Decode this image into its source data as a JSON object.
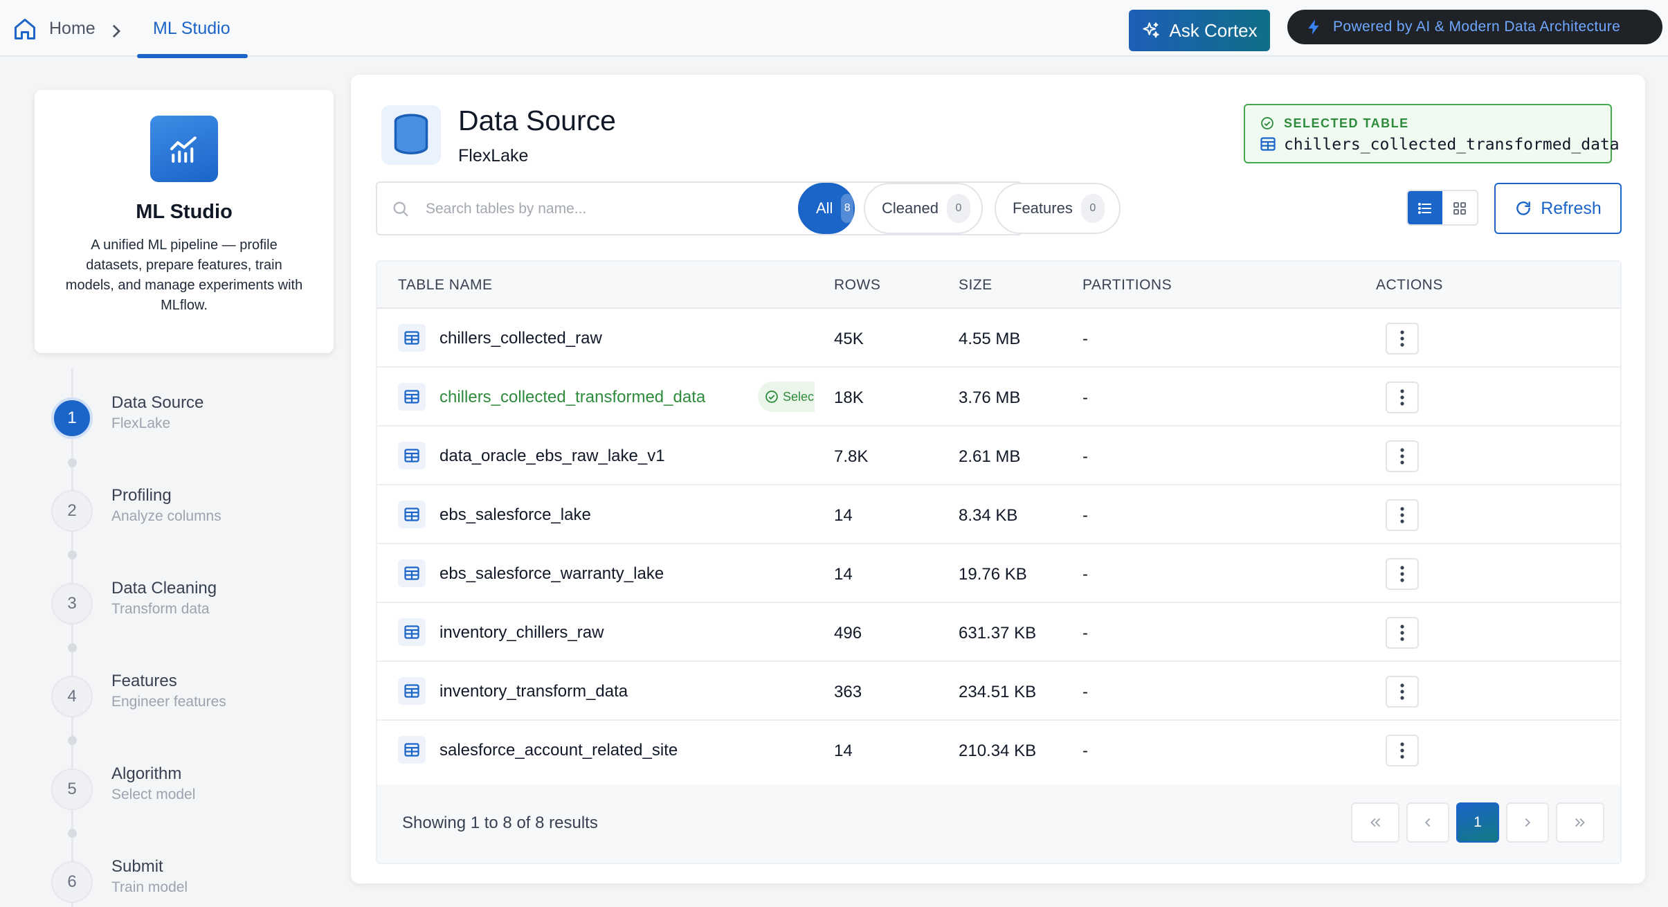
{
  "breadcrumb": {
    "home": "Home",
    "current": "ML Studio"
  },
  "header": {
    "ask_label": "Ask Cortex",
    "powered_label": "Powered by AI & Modern Data Architecture"
  },
  "sidebar": {
    "title": "ML Studio",
    "description": "A unified ML pipeline — profile datasets, prepare features, train models, and manage experiments with MLflow.",
    "steps": [
      {
        "num": "1",
        "title": "Data Source",
        "sub": "FlexLake",
        "active": true
      },
      {
        "num": "2",
        "title": "Profiling",
        "sub": "Analyze columns"
      },
      {
        "num": "3",
        "title": "Data Cleaning",
        "sub": "Transform data"
      },
      {
        "num": "4",
        "title": "Features",
        "sub": "Engineer features"
      },
      {
        "num": "5",
        "title": "Algorithm",
        "sub": "Select model"
      },
      {
        "num": "6",
        "title": "Submit",
        "sub": "Train model"
      }
    ]
  },
  "main": {
    "title": "Data Source",
    "subtitle": "FlexLake",
    "selected_label": "SELECTED TABLE",
    "selected_value": "chillers_collected_transformed_data",
    "search_placeholder": "Search tables by name...",
    "filters": [
      {
        "label": "All",
        "count": "8",
        "active": true
      },
      {
        "label": "Cleaned",
        "count": "0"
      },
      {
        "label": "Features",
        "count": "0"
      }
    ],
    "refresh_label": "Refresh",
    "columns": [
      "TABLE NAME",
      "ROWS",
      "SIZE",
      "PARTITIONS",
      "ACTIONS"
    ],
    "rows": [
      {
        "name": "chillers_collected_raw",
        "rows": "45K",
        "size": "4.55 MB",
        "partitions": "-"
      },
      {
        "name": "chillers_collected_transformed_data",
        "rows": "18K",
        "size": "3.76 MB",
        "partitions": "-",
        "badge": "Selec"
      },
      {
        "name": "data_oracle_ebs_raw_lake_v1",
        "rows": "7.8K",
        "size": "2.61 MB",
        "partitions": "-"
      },
      {
        "name": "ebs_salesforce_lake",
        "rows": "14",
        "size": "8.34 KB",
        "partitions": "-"
      },
      {
        "name": "ebs_salesforce_warranty_lake",
        "rows": "14",
        "size": "19.76 KB",
        "partitions": "-"
      },
      {
        "name": "inventory_chillers_raw",
        "rows": "496",
        "size": "631.37 KB",
        "partitions": "-"
      },
      {
        "name": "inventory_transform_data",
        "rows": "363",
        "size": "234.51 KB",
        "partitions": "-"
      },
      {
        "name": "salesforce_account_related_site",
        "rows": "14",
        "size": "210.34 KB",
        "partitions": "-"
      }
    ],
    "footer_text": "Showing 1 to 8 of 8 results",
    "current_page": "1"
  },
  "colors": {
    "primary": "#1b64c8",
    "selected_green": "#2e8b3c",
    "powered_bg": "#1f2328"
  }
}
